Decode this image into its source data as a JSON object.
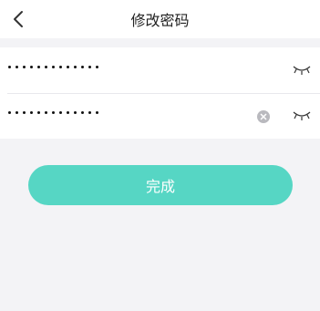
{
  "nav": {
    "title": "修改密码",
    "back_icon": "chevron-left-icon"
  },
  "form": {
    "fields": [
      {
        "masked_value": "•••••••••••••",
        "eye_icon": "eye-closed-icon"
      },
      {
        "masked_value": "•••••••••••••",
        "clear_icon": "clear-icon",
        "eye_icon": "eye-closed-icon"
      }
    ]
  },
  "actions": {
    "done_label": "完成"
  },
  "colors": {
    "accent": "#56d6c4",
    "background": "#f3f3f6"
  }
}
